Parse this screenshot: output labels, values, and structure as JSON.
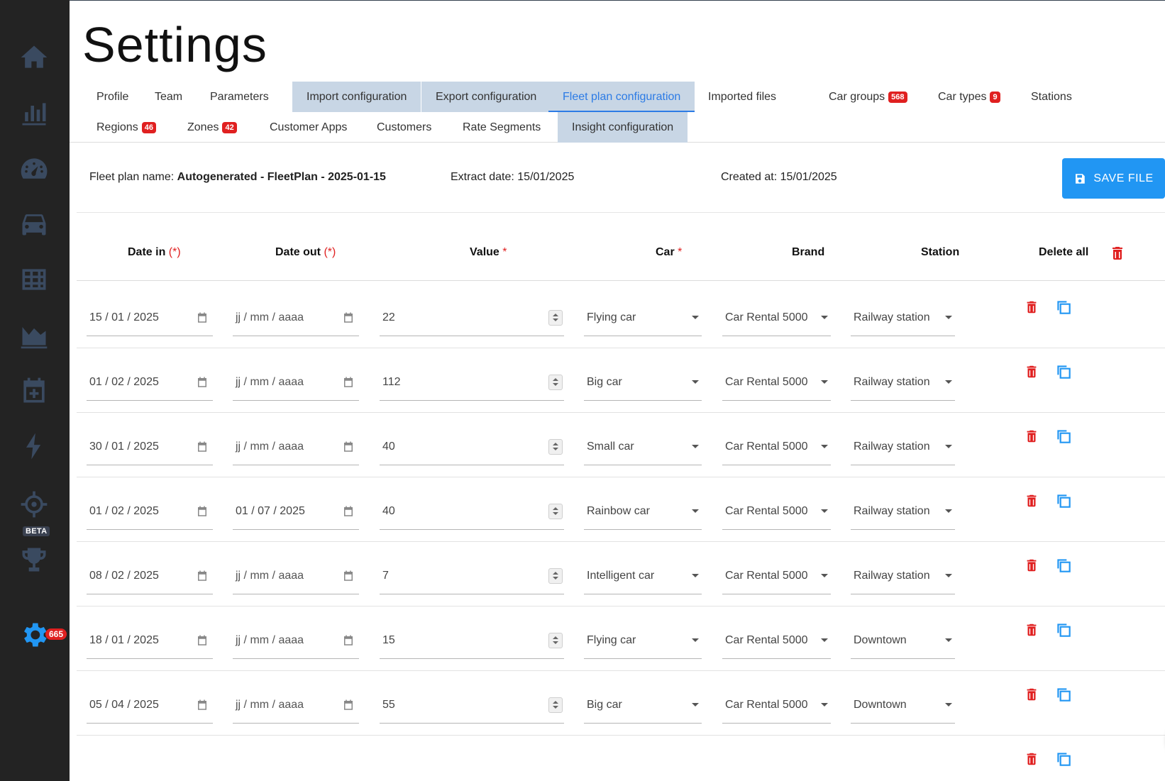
{
  "page": {
    "title": "Settings"
  },
  "colors": {
    "accent": "#2196f3",
    "danger": "#e02020",
    "sidebar": "#232323",
    "highlight_tab": "#c8d6e5"
  },
  "sidebar": {
    "items": [
      {
        "name": "home-icon"
      },
      {
        "name": "bar-chart-icon"
      },
      {
        "name": "dashboard-gauge-icon"
      },
      {
        "name": "car-icon"
      },
      {
        "name": "table-grid-icon"
      },
      {
        "name": "area-chart-icon"
      },
      {
        "name": "calendar-add-icon"
      },
      {
        "name": "lightning-icon"
      },
      {
        "name": "crosshair-icon",
        "tag": "BETA"
      },
      {
        "name": "trophy-icon"
      },
      {
        "name": "gear-icon",
        "badge": "665"
      }
    ]
  },
  "tabs": [
    {
      "label": "Profile"
    },
    {
      "label": "Team"
    },
    {
      "label": "Parameters"
    },
    {
      "label": "Import configuration"
    },
    {
      "label": "Export configuration"
    },
    {
      "label": "Fleet plan configuration"
    },
    {
      "label": "Imported files"
    },
    {
      "label": "Car groups",
      "badge": "568"
    },
    {
      "label": "Car types",
      "badge": "9"
    },
    {
      "label": "Stations"
    },
    {
      "label": "Regions",
      "badge": "46"
    },
    {
      "label": "Zones",
      "badge": "42"
    },
    {
      "label": "Customer Apps"
    },
    {
      "label": "Customers"
    },
    {
      "label": "Rate Segments"
    },
    {
      "label": "Insight configuration"
    }
  ],
  "info": {
    "fleet_plan_label": "Fleet plan name:",
    "fleet_plan_value": "Autogenerated - FleetPlan - 2025-01-15",
    "extract_label": "Extract date:",
    "extract_value": "15/01/2025",
    "created_label": "Created at:",
    "created_value": "15/01/2025",
    "save_label": "SAVE FILE"
  },
  "table": {
    "headers": {
      "date_in": "Date in",
      "date_in_req": "(*)",
      "date_out": "Date out",
      "date_out_req": "(*)",
      "value": "Value",
      "value_req": "*",
      "car": "Car",
      "car_req": "*",
      "brand": "Brand",
      "station": "Station",
      "delete_all": "Delete all"
    },
    "rows": [
      {
        "date_in": "15 / 01 / 2025",
        "date_out": "jj / mm / aaaa",
        "value": "22",
        "car": "Flying car",
        "brand": "Car Rental 5000",
        "station": "Railway station"
      },
      {
        "date_in": "01 / 02 / 2025",
        "date_out": "jj / mm / aaaa",
        "value": "112",
        "car": "Big car",
        "brand": "Car Rental 5000",
        "station": "Railway station"
      },
      {
        "date_in": "30 / 01 / 2025",
        "date_out": "jj / mm / aaaa",
        "value": "40",
        "car": "Small car",
        "brand": "Car Rental 5000",
        "station": "Railway station"
      },
      {
        "date_in": "01 / 02 / 2025",
        "date_out": "01 / 07 / 2025",
        "value": "40",
        "car": "Rainbow car",
        "brand": "Car Rental 5000",
        "station": "Railway station"
      },
      {
        "date_in": "08 / 02 / 2025",
        "date_out": "jj / mm / aaaa",
        "value": "7",
        "car": "Intelligent car",
        "brand": "Car Rental 5000",
        "station": "Railway station"
      },
      {
        "date_in": "18 / 01 / 2025",
        "date_out": "jj / mm / aaaa",
        "value": "15",
        "car": "Flying car",
        "brand": "Car Rental 5000",
        "station": "Downtown"
      },
      {
        "date_in": "05 / 04 / 2025",
        "date_out": "jj / mm / aaaa",
        "value": "55",
        "car": "Big car",
        "brand": "Car Rental 5000",
        "station": "Downtown"
      }
    ]
  }
}
